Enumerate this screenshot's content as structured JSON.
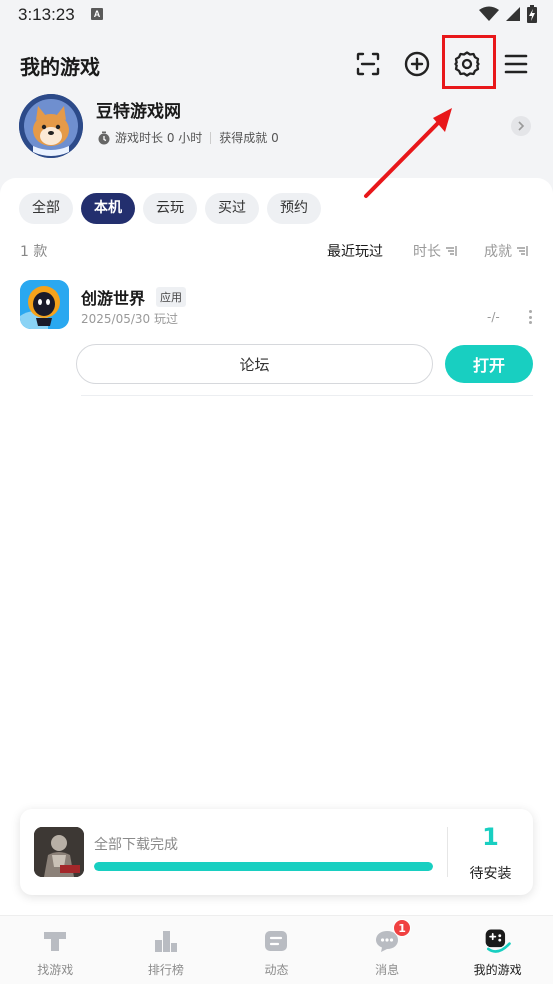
{
  "status_bar": {
    "time": "3:13:23",
    "notif_letter": "A"
  },
  "header": {
    "title": "我的游戏",
    "icons": [
      "scan-icon",
      "add-circle-icon",
      "settings-icon",
      "menu-icon"
    ]
  },
  "profile": {
    "username": "豆特游戏网",
    "play_time": "游戏时长 0 小时",
    "achievements": "获得成就 0"
  },
  "tabs": [
    {
      "label": "全部",
      "active": false
    },
    {
      "label": "本机",
      "active": true
    },
    {
      "label": "云玩",
      "active": false
    },
    {
      "label": "买过",
      "active": false
    },
    {
      "label": "预约",
      "active": false
    }
  ],
  "list": {
    "count": "1 款",
    "sort_recent": "最近玩过",
    "sort_duration": "时长",
    "sort_achievement": "成就"
  },
  "game": {
    "name": "创游世界",
    "badge": "应用",
    "last_played": "2025/05/30 玩过",
    "right_value": "-/-",
    "forum_label": "论坛",
    "open_label": "打开"
  },
  "download": {
    "status": "全部下载完成",
    "progress": 1.0,
    "pending_count": "1",
    "pending_label": "待安装"
  },
  "bottom_nav": [
    {
      "label": "找游戏",
      "icon": "find-game-icon",
      "active": false
    },
    {
      "label": "排行榜",
      "icon": "ranking-icon",
      "active": false
    },
    {
      "label": "动态",
      "icon": "feed-icon",
      "active": false
    },
    {
      "label": "消息",
      "icon": "message-icon",
      "active": false,
      "badge": "1"
    },
    {
      "label": "我的游戏",
      "icon": "my-games-icon",
      "active": true
    }
  ],
  "colors": {
    "accent": "#18cfc1",
    "tab_active": "#232f6e",
    "annotation": "#e8171a"
  }
}
